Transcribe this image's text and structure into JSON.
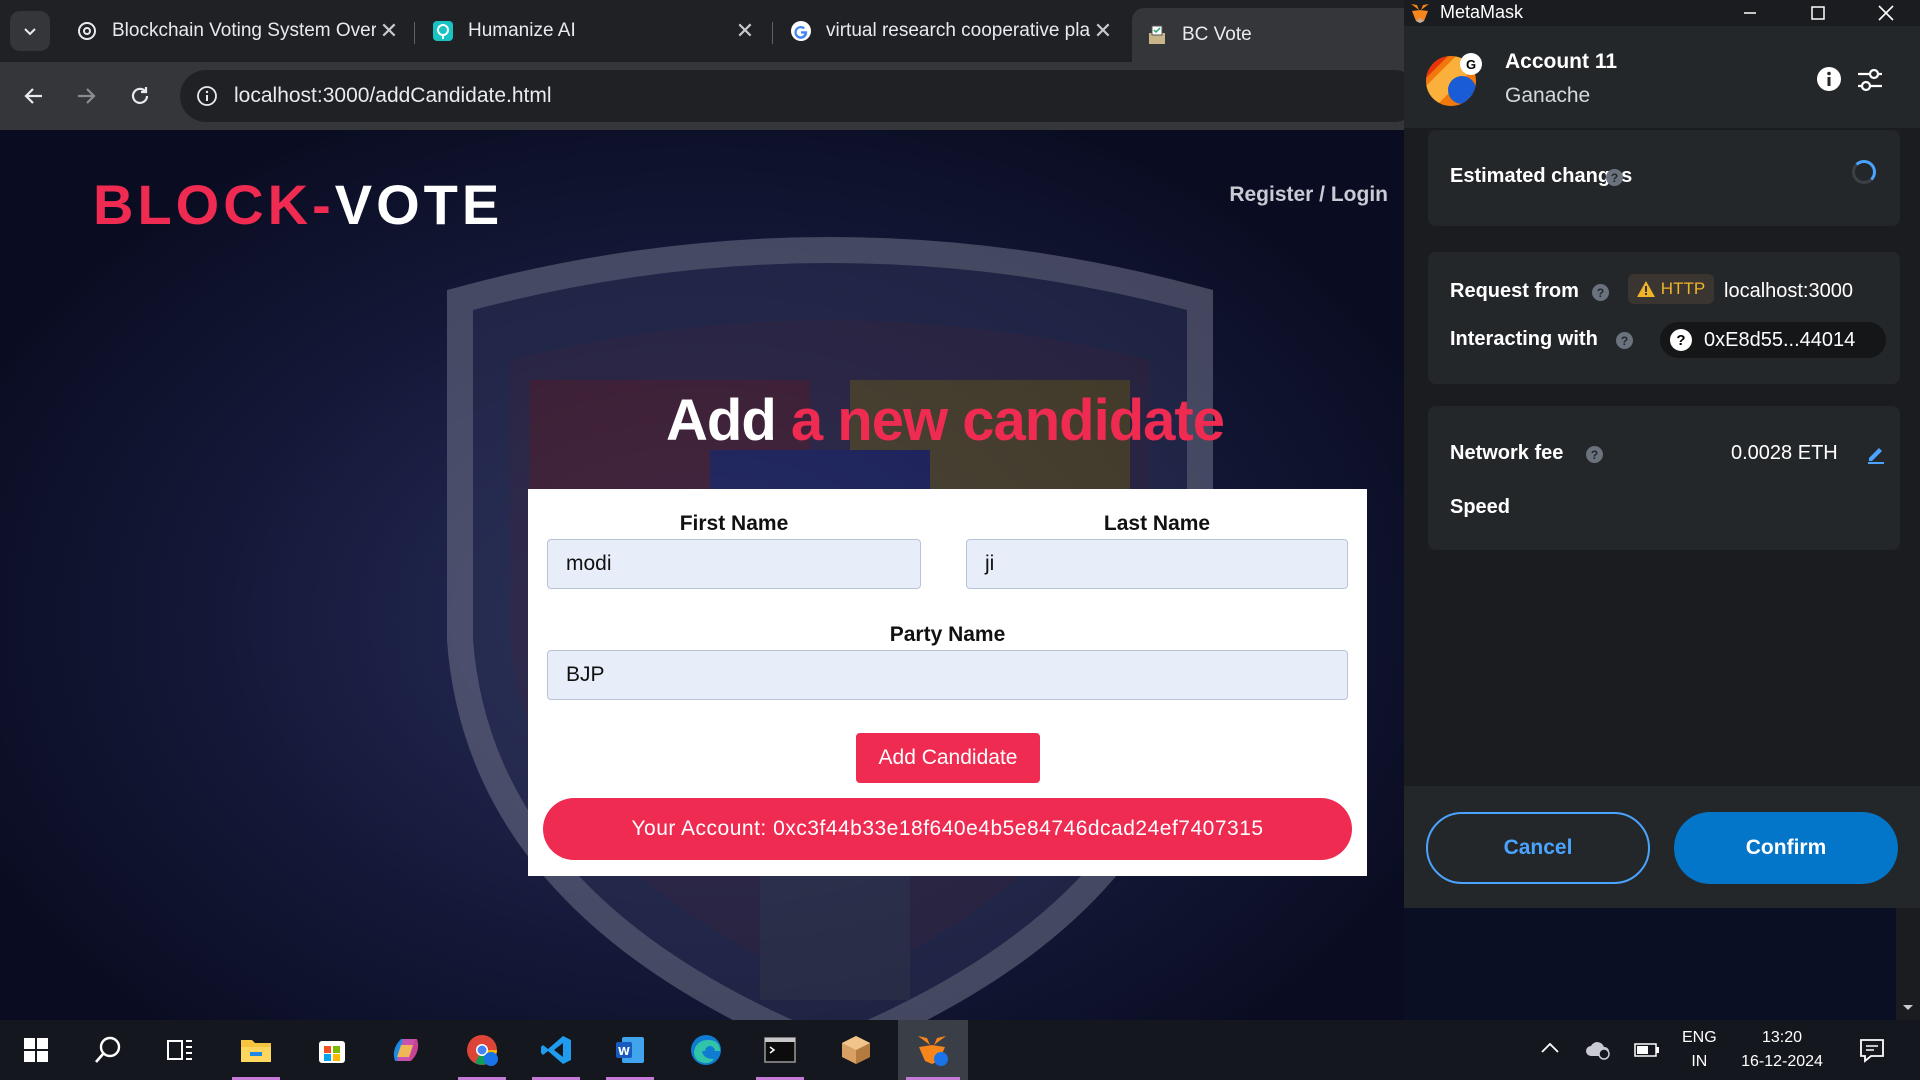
{
  "browser": {
    "tabs": [
      {
        "title": "Blockchain Voting System Overv",
        "icon": "chatgpt-icon",
        "active": false
      },
      {
        "title": "Humanize AI",
        "icon": "humanize-ai-icon",
        "active": false
      },
      {
        "title": "virtual research cooperative pla",
        "icon": "google-icon",
        "active": false
      },
      {
        "title": "BC Vote",
        "icon": "ballot-icon",
        "active": true
      }
    ],
    "close_glyph": "✕",
    "url": "localhost:3000/addCandidate.html"
  },
  "site": {
    "logo_part1": "BLOCK-",
    "logo_part2": "VOTE",
    "nav_link": "Register / Login",
    "heading_white": "Add",
    "heading_red": "a new candidate",
    "accent_color": "#ef2b52"
  },
  "form": {
    "first_name_label": "First Name",
    "first_name_value": "modi",
    "last_name_label": "Last Name",
    "last_name_value": "ji",
    "party_label": "Party Name",
    "party_value": "BJP",
    "submit_label": "Add Candidate",
    "account_text": "Your Account: 0xc3f44b33e18f640e4b5e84746dcad24ef7407315"
  },
  "metamask": {
    "window_title": "MetaMask",
    "account_name": "Account 11",
    "network": "Ganache",
    "network_badge": "G",
    "estimated_changes_label": "Estimated changes",
    "request_from_label": "Request from",
    "http_badge": "HTTP",
    "request_origin": "localhost:3000",
    "interacting_with_label": "Interacting with",
    "contract_address": "0xE8d55...44014",
    "network_fee_label": "Network fee",
    "network_fee_value": "0.0028 ETH",
    "speed_label": "Speed",
    "cancel_label": "Cancel",
    "confirm_label": "Confirm",
    "primary_color": "#0376c9"
  },
  "taskbar": {
    "apps": [
      "windows-start-icon",
      "search-icon",
      "task-view-icon",
      "file-explorer-icon",
      "microsoft-store-icon",
      "copilot-icon",
      "chrome-icon",
      "vscode-icon",
      "word-icon",
      "edge-icon",
      "terminal-icon",
      "package-icon",
      "metamask-icon"
    ],
    "language": "ENG",
    "region": "IN",
    "time": "13:20",
    "date": "16-12-2024"
  }
}
